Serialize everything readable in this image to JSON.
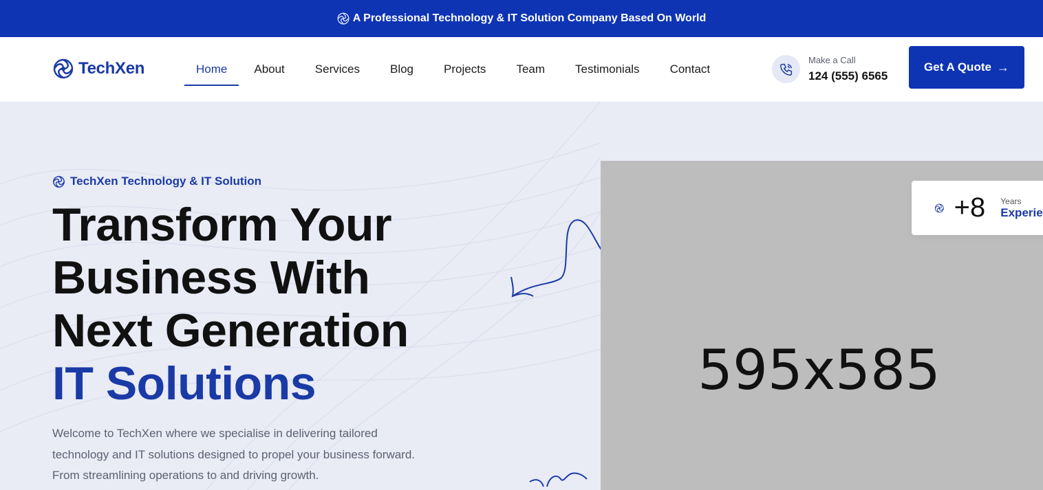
{
  "topbar": {
    "text": "A Professional Technology & IT Solution Company Based On World"
  },
  "header": {
    "brand": "TechXen",
    "nav": [
      "Home",
      "About",
      "Services",
      "Blog",
      "Projects",
      "Team",
      "Testimonials",
      "Contact"
    ],
    "active_nav": "Home",
    "call_label": "Make a Call",
    "call_number": "124 (555) 6565",
    "quote_button": "Get A Quote"
  },
  "hero": {
    "tagline": "TechXen Technology & IT Solution",
    "headline_lines": [
      "Transform Your",
      "Business With",
      "Next Generation"
    ],
    "headline_accent": "IT Solutions",
    "description_lines": [
      "Welcome to TechXen where we specialise in delivering tailored",
      "technology and IT solutions designed to propel your business forward.",
      "From streamlining operations to and driving growth."
    ],
    "image_placeholder": "595x585",
    "experience_number": "+8",
    "experience_years_label": "Years",
    "experience_label": "Experience"
  },
  "colors": {
    "primary": "#0e34b4",
    "accent": "#1a3aa6",
    "background": "#e9ebf5"
  },
  "icons": {
    "logo": "swirl-logo-icon",
    "phone": "phone-icon",
    "arrow": "arrow-right-icon"
  }
}
